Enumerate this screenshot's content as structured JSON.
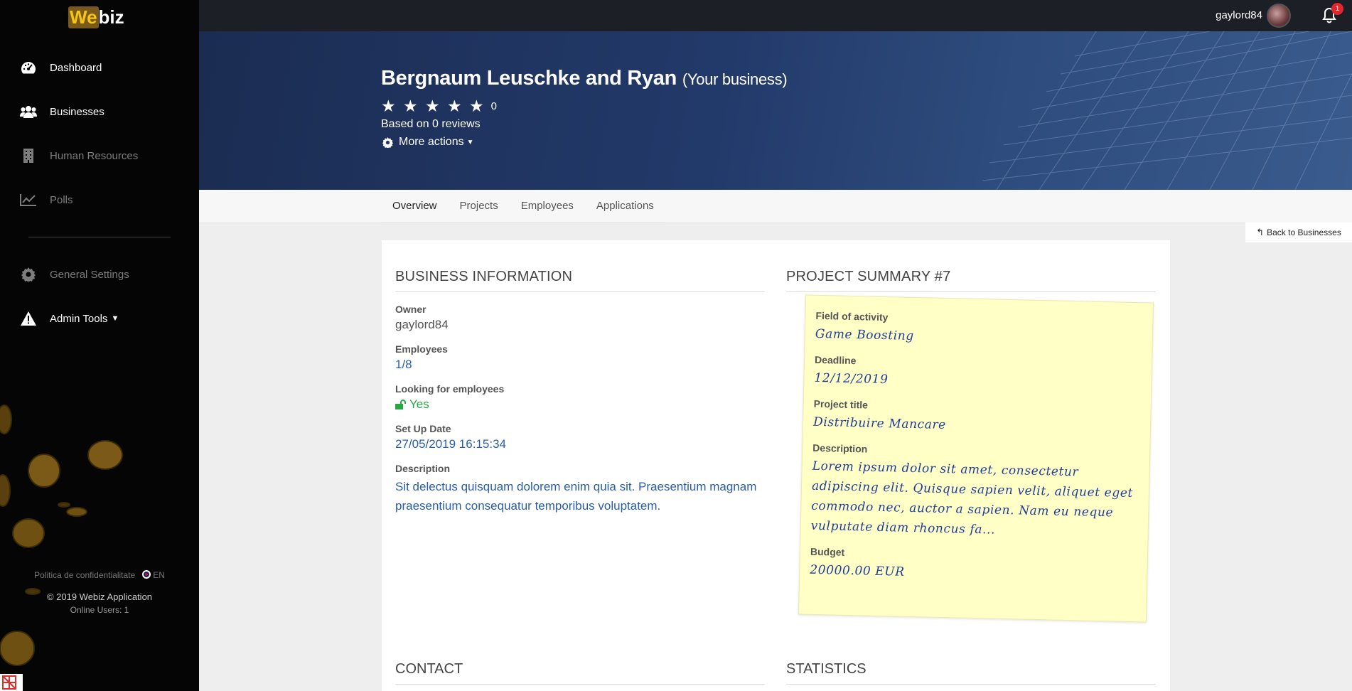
{
  "brand": {
    "logo_text_a": "We",
    "logo_text_b": "biz"
  },
  "sidebar": {
    "items": [
      {
        "label": "Dashboard",
        "icon": "dashboard-icon"
      },
      {
        "label": "Businesses",
        "icon": "users-icon"
      },
      {
        "label": "Human Resources",
        "icon": "building-icon"
      },
      {
        "label": "Polls",
        "icon": "chart-line-icon"
      },
      {
        "label": "General Settings",
        "icon": "gear-icon"
      },
      {
        "label": "Admin Tools",
        "icon": "warning-icon"
      }
    ],
    "footer": {
      "privacy": "Politica de confidentialitate",
      "language": "EN",
      "copyright": "© 2019 Webiz Application",
      "online_users": "Online Users: 1"
    }
  },
  "topbar": {
    "username": "gaylord84",
    "notification_count": "1"
  },
  "business": {
    "name": "Bergnaum Leuschke and Ryan",
    "name_suffix": "(Your business)",
    "stars": "★ ★ ★ ★ ★",
    "rating_count": "0",
    "reviews_text": "Based on 0 reviews",
    "more_actions": "More actions"
  },
  "tabs": [
    "Overview",
    "Projects",
    "Employees",
    "Applications"
  ],
  "back_button": "Back to Businesses",
  "business_info": {
    "title": "Business Information",
    "owner_label": "Owner",
    "owner": "gaylord84",
    "employees_label": "Employees",
    "employees": "1/8",
    "looking_label": "Looking for employees",
    "looking": "Yes",
    "setup_label": "Set Up Date",
    "setup": "27/05/2019 16:15:34",
    "description_label": "Description",
    "description": "Sit delectus quisquam dolorem enim quia sit. Praesentium magnam praesentium consequatur temporibus voluptatem."
  },
  "project_summary": {
    "title": "Project Summary #7",
    "field_label": "Field of activity",
    "field": "Game Boosting",
    "deadline_label": "Deadline",
    "deadline": "12/12/2019",
    "project_title_label": "Project title",
    "project_title": "Distribuire Mancare",
    "description_label": "Description",
    "description": "Lorem ipsum dolor sit amet, consectetur adipiscing elit. Quisque sapien velit, aliquet eget commodo nec, auctor a sapien. Nam eu neque vulputate diam rhoncus fa...",
    "budget_label": "Budget",
    "budget": "20000.00 EUR"
  },
  "sections": {
    "contact": "Contact",
    "statistics": "Statistics"
  },
  "colors": {
    "accent_link": "#2a5ea8",
    "success": "#28a745",
    "hero": "#223a6a",
    "note": "#ffffc6",
    "badge": "#e3262c"
  }
}
